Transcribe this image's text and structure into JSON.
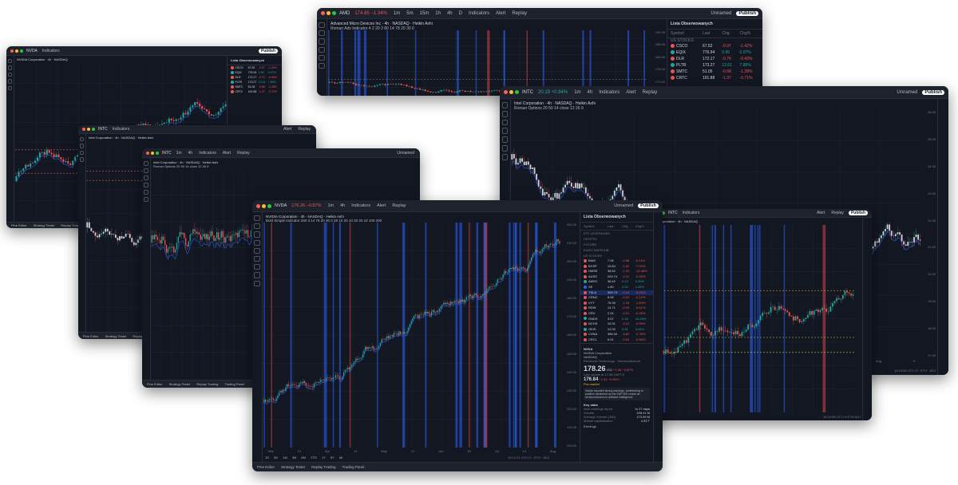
{
  "common": {
    "indicators": "Indicators",
    "alert": "Alert",
    "replay": "Replay",
    "unnamed": "Unnamed",
    "publish": "Publish",
    "timeframes": [
      "1m",
      "5m",
      "15m",
      "1h",
      "4h",
      "D"
    ]
  },
  "windows": {
    "amd": {
      "symbol": "AMD",
      "price_line": "174.85 −1.34%",
      "legend": "Advanced Micro Devices Inc · 4h · NASDAQ · Heikin Ashi",
      "indicator_line": "Roman Adv Indicator 4 2 20 2 80 14 78 20 30 0",
      "price_axis": [
        "190.00",
        "185.00",
        "180.00",
        "175.00",
        "170.00",
        "165.00"
      ],
      "watchlist": {
        "title": "Lista Obserwowanych",
        "columns": [
          "Symbol",
          "Last",
          "Chg",
          "Chg%"
        ],
        "section": "US STOCKS",
        "rows": [
          {
            "sym": "CSCO",
            "last": "67.52",
            "chg": "-0.97",
            "pct": "-1.42%",
            "c": "#ef5350"
          },
          {
            "sym": "EQIX",
            "last": "776.94",
            "chg": "0.95",
            "pct": "0.07%",
            "c": "#26a69a"
          },
          {
            "sym": "DLR",
            "last": "172.17",
            "chg": "-0.74",
            "pct": "-0.43%",
            "c": "#ef5350"
          },
          {
            "sym": "PLTR",
            "last": "173.27",
            "chg": "12.61",
            "pct": "7.85%",
            "c": "#26a69a"
          },
          {
            "sym": "SMTC",
            "last": "51.05",
            "chg": "-0.68",
            "pct": "-1.28%",
            "c": "#ef5350"
          },
          {
            "sym": "CRTC",
            "last": "191.88",
            "chg": "-1.37",
            "pct": "-0.71%",
            "c": "#ef5350"
          }
        ]
      }
    },
    "intc_top": {
      "symbol": "INTC",
      "price_line": "20.19 +0.84%",
      "legend": "Intel Corporation · 4h · NASDAQ · Heikin Ashi",
      "indicator_line": "Roman Options 20 50 14 close 12 26 9",
      "price_axis": [
        "26.00",
        "25.00",
        "24.00",
        "23.00",
        "22.00",
        "21.00",
        "20.00",
        "19.00",
        "18.00",
        "17.00"
      ],
      "time_axis": [
        "Jun",
        "Jul",
        "Aug",
        "9"
      ],
      "time_status": "19:10:58 UTC+2 · ETH · ADJ"
    },
    "small_a": {
      "symbol": "NVDA",
      "legend": "NVIDIA Corporation · 4h · NASDAQ",
      "bottom": [
        "Pine Editor",
        "Strategy Tester",
        "Replay Trading",
        "Trading Panel"
      ]
    },
    "small_b": {
      "symbol": "INTC",
      "legend": "Intel Corporation · 4h · NASDAQ · Heikin Ashi",
      "bottom": [
        "Pine Editor",
        "Strategy Tester",
        "Replay Trading"
      ]
    },
    "mid_intc": {
      "symbol": "INTC",
      "legend": "Intel Corporation · 4h · NASDAQ · Heikin Ashi",
      "indicator_line": "Roman Options 20 50 14 close 12 26 9",
      "bottom": [
        "Pine Editor",
        "Strategy Tester",
        "Replay Trading",
        "Trading Panel"
      ]
    },
    "right_mid": {
      "symbol": "INTC",
      "legend": "Intel Corporation · 4h · NASDAQ",
      "status": "19:10:58 UTC+2 ETH ADJ"
    },
    "nvda": {
      "symbol": "NVDA",
      "price_line": "176.26 −0.87%",
      "legend": "NVIDIA Corporation · 4h · NASDAQ · Heikin Ashi",
      "indicator_line": "Bold Simple Indicator 280 3 14 78 20 30 0 28 10 20 10 20 20 10 100 200",
      "price_axis": [
        "220.00",
        "210.00",
        "200.00",
        "190.00",
        "180.00",
        "170.00",
        "160.00",
        "150.00",
        "140.00",
        "130.00",
        "120.00",
        "110.00",
        "100.00"
      ],
      "time_axis": [
        "Mar",
        "21",
        "Apr",
        "14",
        "May",
        "12",
        "Jun",
        "16",
        "Jul",
        "14",
        "Aug"
      ],
      "time_status": "19:12:21 UTC+2 · ETH · ADJ",
      "ranges": [
        "1D",
        "5D",
        "1M",
        "3M",
        "6M",
        "YTD",
        "1Y",
        "5Y",
        "All"
      ],
      "bottom": [
        "Pine Editor",
        "Strategy Tester",
        "Replay Trading",
        "Trading Panel"
      ],
      "watchlist": {
        "title": "Lista Obserwowanych",
        "columns": [
          "Symbol",
          "Last",
          "Chg",
          "Chg%"
        ],
        "sections": [
          "ETF LEVERAGED",
          "CRYPTO",
          "FUTURE",
          "EURO SAFEHUB",
          "US STOCKS"
        ],
        "rows": [
          {
            "sym": "BAM",
            "last": "7.04",
            "chg": "-0.08",
            "pct": "-0.11%",
            "c": "#ef5350"
          },
          {
            "sym": "BYSP",
            "last": "19.84",
            "chg": "-1.82",
            "pct": "-7.94%",
            "c": "#ef5350"
          },
          {
            "sym": "HMSE",
            "last": "38.52",
            "chg": "-1.02",
            "pct": "-12.48%",
            "c": "#ef5350"
          },
          {
            "sym": "AUSS",
            "last": "209.74",
            "chg": "-0.11",
            "pct": "-0.05%",
            "c": "#ef5350"
          },
          {
            "sym": "AMSC",
            "last": "38.42",
            "chg": "0.15",
            "pct": "0.39%",
            "c": "#26a69a"
          },
          {
            "sym": "SE",
            "last": "1.60",
            "chg": "0.02",
            "pct": "1.26%",
            "c": "#2962ff"
          },
          {
            "sym": "TSLA",
            "last": "309.73",
            "chg": "-0.14",
            "pct": "-0.05%",
            "c": "#ef5350",
            "sel": true
          },
          {
            "sym": "CRNC",
            "last": "8.05",
            "chg": "-0.01",
            "pct": "-0.12%",
            "c": "#ef5350"
          },
          {
            "sym": "VYT",
            "last": "76.39",
            "chg": "-1.43",
            "pct": "-1.84%",
            "c": "#ef5350"
          },
          {
            "sym": "RDW",
            "last": "14.71",
            "chg": "-0.09",
            "pct": "-0.61%",
            "c": "#ef5350"
          },
          {
            "sym": "CRV",
            "last": "2.24",
            "chg": "-0.01",
            "pct": "-0.45%",
            "c": "#ef5350"
          },
          {
            "sym": "ONDS",
            "last": "3.07",
            "chg": "0.43",
            "pct": "16.28%",
            "c": "#26a69a"
          },
          {
            "sym": "NCHS",
            "last": "10.31",
            "chg": "-0.12",
            "pct": "-0.95%",
            "c": "#ef5350"
          },
          {
            "sym": "OKIS",
            "last": "12.00",
            "chg": "0.51",
            "pct": "4.44%",
            "c": "#26a69a"
          },
          {
            "sym": "CVNA",
            "last": "356.34",
            "chg": "-9.82",
            "pct": "-2.76%",
            "c": "#ef5350"
          },
          {
            "sym": "CRCL",
            "last": "6.01",
            "chg": "-0.04",
            "pct": "-0.66%",
            "c": "#ef5350"
          }
        ],
        "detail": {
          "symbol": "NVDA",
          "name": "NVIDIA Corporation",
          "exchange": "NASDAQ",
          "sector": "Electronic Technology · Semiconductors",
          "price": "178.26",
          "currency": "USD",
          "chg": "−1.56 −0.87%",
          "last_update": "Last update at 17:48 GMT+2",
          "post_price": "176.84",
          "post_chg": "−1.42 −0.80%",
          "post_label": "Pre-market",
          "news": "Nvidia reported strong earnings, contributing to positive sentiment as the S&P 500 closes at... semiconductors in artificial intelligence",
          "stats_title": "Key stats",
          "stats": [
            {
              "k": "Next earnings report",
              "v": "In 27 days"
            },
            {
              "k": "Volume",
              "v": "198.41 M"
            },
            {
              "k": "Average Volume (30D)",
              "v": "173.99 M"
            },
            {
              "k": "Market capitalization",
              "v": "4.33 T"
            }
          ],
          "earnings": "Earnings"
        }
      }
    }
  }
}
